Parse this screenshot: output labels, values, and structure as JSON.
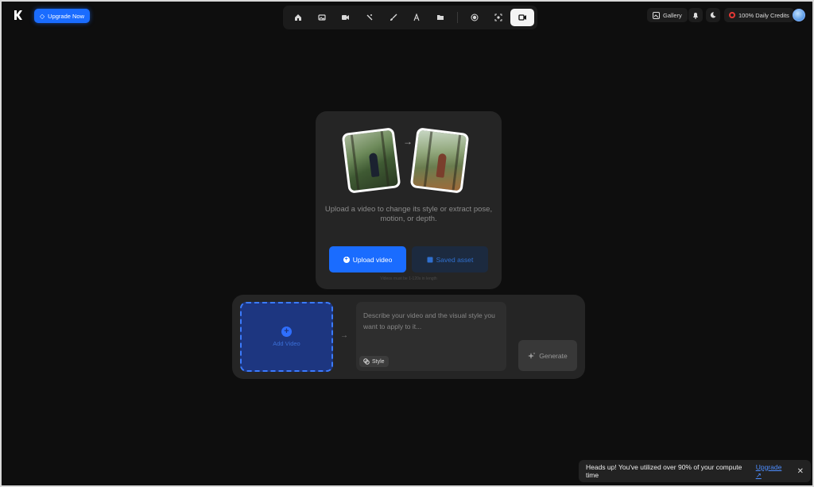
{
  "brand": {
    "logo_icon": "k-logo-icon"
  },
  "header": {
    "upgrade_label": "Upgrade Now",
    "gallery_label": "Gallery",
    "credits_label": "100% Daily Credits"
  },
  "toolbar": {
    "tools": [
      {
        "icon": "home-icon",
        "glyph": "⌂"
      },
      {
        "icon": "image-icon",
        "glyph": "▣"
      },
      {
        "icon": "video-icon",
        "glyph": "■"
      },
      {
        "icon": "magic-wand-icon",
        "glyph": "⁄"
      },
      {
        "icon": "brush-icon",
        "glyph": "✎"
      },
      {
        "icon": "text-icon",
        "glyph": "A"
      },
      {
        "icon": "folder-icon",
        "glyph": "▬"
      },
      {
        "icon": "record-icon",
        "glyph": "◉"
      },
      {
        "icon": "scan-icon",
        "glyph": "⌗"
      },
      {
        "icon": "video-camera-icon",
        "glyph": "■",
        "active": true
      }
    ]
  },
  "upload_card": {
    "description": "Upload a video to change its style or extract pose, motion, or depth.",
    "upload_label": "Upload video",
    "saved_label": "Saved asset",
    "note": "Videos must be 1-120s in length"
  },
  "generator": {
    "add_video_label": "Add Video",
    "prompt_placeholder": "Describe your video and the visual style you want to apply to it...",
    "style_label": "Style",
    "generate_label": "Generate"
  },
  "toast": {
    "message": "Heads up! You've utilized over 90% of your compute time",
    "link_label": "Upgrade ↗",
    "close_label": "✕"
  },
  "colors": {
    "accent": "#1a6cff",
    "danger": "#e53935",
    "background": "#0e0e0e"
  }
}
